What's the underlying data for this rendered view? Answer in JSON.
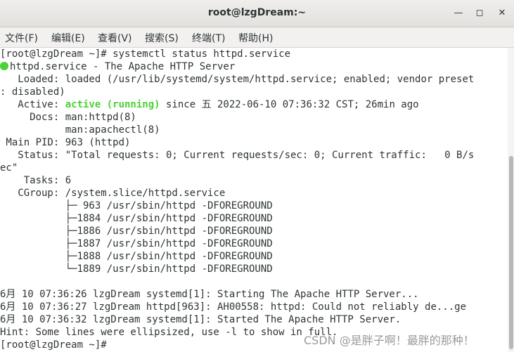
{
  "window": {
    "title": "root@lzgDream:~"
  },
  "menu": [
    "文件(F)",
    "编辑(E)",
    "查看(V)",
    "搜索(S)",
    "终端(T)",
    "帮助(H)"
  ],
  "terminal": {
    "prompt1": "[root@lzgDream ~]# systemctl status httpd.service",
    "unit": "httpd.service - The Apache HTTP Server",
    "loaded": "   Loaded: loaded (/usr/lib/systemd/system/httpd.service; enabled; vendor preset",
    "loaded_wrap": ": disabled)",
    "active_label": "   Active: ",
    "active_state": "active (running)",
    "active_rest": " since 五 2022-06-10 07:36:32 CST; 26min ago",
    "docs1": "     Docs: man:httpd(8)",
    "docs2": "           man:apachectl(8)",
    "mainpid": " Main PID: 963 (httpd)",
    "status": "   Status: \"Total requests: 0; Current requests/sec: 0; Current traffic:   0 B/s",
    "status_wrap": "ec\"",
    "tasks": "    Tasks: 6",
    "cgroup": "   CGroup: /system.slice/httpd.service",
    "proc1": "           ├─ 963 /usr/sbin/httpd -DFOREGROUND",
    "proc2": "           ├─1884 /usr/sbin/httpd -DFOREGROUND",
    "proc3": "           ├─1886 /usr/sbin/httpd -DFOREGROUND",
    "proc4": "           ├─1887 /usr/sbin/httpd -DFOREGROUND",
    "proc5": "           ├─1888 /usr/sbin/httpd -DFOREGROUND",
    "proc6": "           └─1889 /usr/sbin/httpd -DFOREGROUND",
    "log1": "6月 10 07:36:26 lzgDream systemd[1]: Starting The Apache HTTP Server...",
    "log2": "6月 10 07:36:27 lzgDream httpd[963]: AH00558: httpd: Could not reliably de...ge",
    "log3": "6月 10 07:36:32 lzgDream systemd[1]: Started The Apache HTTP Server.",
    "hint": "Hint: Some lines were ellipsized, use -l to show in full.",
    "prompt2": "[root@lzgDream ~]# "
  },
  "watermark": "CSDN @是胖子啊！最胖的那种！"
}
